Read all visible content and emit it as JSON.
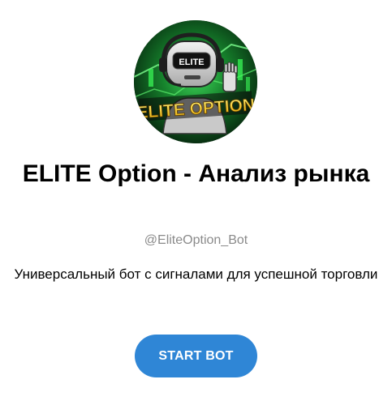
{
  "bot": {
    "title": "ELITE Option - Анализ рынка",
    "username": "@EliteOption_Bot",
    "description": "Универсальный бот с сигналами для успешной торговли",
    "avatar_icon": "robot-logo-icon",
    "avatar_logo_text": "ELITE OPTION",
    "avatar_badge_text": "ELITE"
  },
  "actions": {
    "start_label": "START BOT"
  },
  "colors": {
    "button": "#2f86d6",
    "username": "#8a8a8a",
    "avatar_bg": "#0b2a12",
    "logo_yellow": "#f5c518"
  }
}
